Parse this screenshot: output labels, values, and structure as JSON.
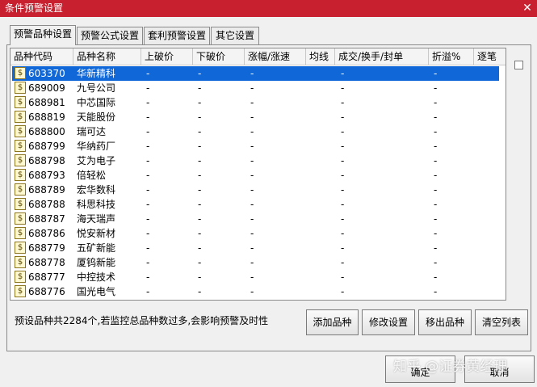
{
  "window": {
    "title": "条件预警设置",
    "close_glyph": "✕"
  },
  "tabs": [
    {
      "label": "预警品种设置",
      "active": true
    },
    {
      "label": "预警公式设置",
      "active": false
    },
    {
      "label": "套利预警设置",
      "active": false
    },
    {
      "label": "其它设置",
      "active": false
    }
  ],
  "list": {
    "columns": [
      "品种代码",
      "品种名称",
      "上破价",
      "下破价",
      "涨幅/涨速",
      "均线",
      "成交/换手/封单",
      "折溢%",
      "逐笔"
    ],
    "row_icon_glyph": "$",
    "rows": [
      {
        "code": "603370",
        "name": "华新精科",
        "up": "-",
        "down": "-",
        "change": "-",
        "turnover": "-",
        "premium": "-",
        "selected": true
      },
      {
        "code": "689009",
        "name": "九号公司",
        "up": "-",
        "down": "-",
        "change": "-",
        "turnover": "-",
        "premium": "-"
      },
      {
        "code": "688981",
        "name": "中芯国际",
        "up": "-",
        "down": "-",
        "change": "-",
        "turnover": "-",
        "premium": "-"
      },
      {
        "code": "688819",
        "name": "天能股份",
        "up": "-",
        "down": "-",
        "change": "-",
        "turnover": "-",
        "premium": "-"
      },
      {
        "code": "688800",
        "name": "瑞可达",
        "up": "-",
        "down": "-",
        "change": "-",
        "turnover": "-",
        "premium": "-"
      },
      {
        "code": "688799",
        "name": "华纳药厂",
        "up": "-",
        "down": "-",
        "change": "-",
        "turnover": "-",
        "premium": "-"
      },
      {
        "code": "688798",
        "name": "艾为电子",
        "up": "-",
        "down": "-",
        "change": "-",
        "turnover": "-",
        "premium": "-"
      },
      {
        "code": "688793",
        "name": "倍轻松",
        "up": "-",
        "down": "-",
        "change": "-",
        "turnover": "-",
        "premium": "-"
      },
      {
        "code": "688789",
        "name": "宏华数科",
        "up": "-",
        "down": "-",
        "change": "-",
        "turnover": "-",
        "premium": "-"
      },
      {
        "code": "688788",
        "name": "科思科技",
        "up": "-",
        "down": "-",
        "change": "-",
        "turnover": "-",
        "premium": "-"
      },
      {
        "code": "688787",
        "name": "海天瑞声",
        "up": "-",
        "down": "-",
        "change": "-",
        "turnover": "-",
        "premium": "-"
      },
      {
        "code": "688786",
        "name": "悦安新材",
        "up": "-",
        "down": "-",
        "change": "-",
        "turnover": "-",
        "premium": "-"
      },
      {
        "code": "688779",
        "name": "五矿新能",
        "up": "-",
        "down": "-",
        "change": "-",
        "turnover": "-",
        "premium": "-"
      },
      {
        "code": "688778",
        "name": "厦钨新能",
        "up": "-",
        "down": "-",
        "change": "-",
        "turnover": "-",
        "premium": "-"
      },
      {
        "code": "688777",
        "name": "中控技术",
        "up": "-",
        "down": "-",
        "change": "-",
        "turnover": "-",
        "premium": "-"
      },
      {
        "code": "688776",
        "name": "国光电气",
        "up": "-",
        "down": "-",
        "change": "-",
        "turnover": "-",
        "premium": "-"
      }
    ]
  },
  "status": {
    "text": "预设品种共2284个,若监控总品种数过多,会影响预警及时性"
  },
  "actions": {
    "add": "添加品种",
    "modify": "修改设置",
    "remove": "移出品种",
    "clear": "清空列表"
  },
  "footer": {
    "ok": "确定",
    "cancel": "取消"
  },
  "watermark": {
    "text": "知乎 @证券黄经理"
  },
  "colors": {
    "titlebar": "#c8202f",
    "selection": "#1068d8"
  }
}
